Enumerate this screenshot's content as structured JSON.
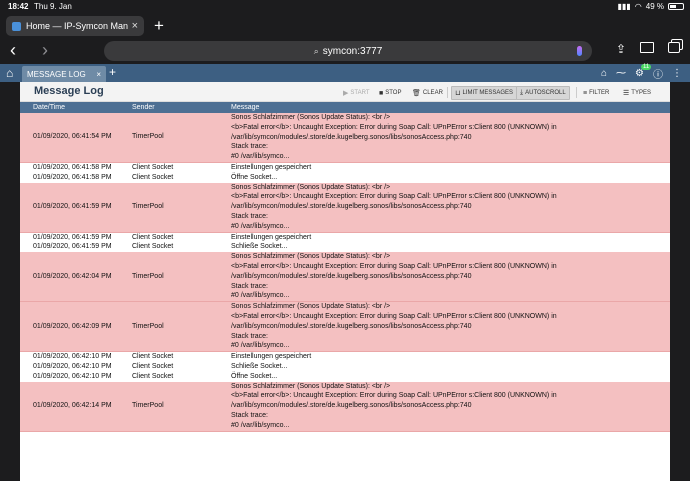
{
  "status": {
    "time": "18:42",
    "date": "Thu 9. Jan",
    "battery": "49 %",
    "battery_level": 0.49
  },
  "browser": {
    "tab_title": "Home — IP-Symcon Man",
    "url": "symcon:3777"
  },
  "app": {
    "tab_label": "MESSAGE LOG",
    "notification_count": "11"
  },
  "panel": {
    "title": "Message Log",
    "toolbar": {
      "start": "START",
      "stop": "STOP",
      "clear": "CLEAR",
      "limit": "LIMIT MESSAGES",
      "autoscroll": "AUTOSCROLL",
      "filter": "FILTER",
      "types": "TYPES"
    },
    "columns": [
      "Date/Time",
      "Sender",
      "Message"
    ]
  },
  "rows": [
    {
      "type": "err",
      "dt": "01/09/2020, 06:41:54 PM",
      "sender": "TimerPool",
      "message": "Sonos Schlafzimmer (Sonos Update Status): <br />\n<b>Fatal error</b>: Uncaught Exception: Error during Soap Call: UPnPError s:Client 800 (UNKNOWN) in\n/var/lib/symcon/modules/.store/de.kugelberg.sonos/libs/sonosAccess.php:740\nStack trace:\n#0 /var/lib/symco..."
    },
    {
      "type": "info",
      "dt": "01/09/2020, 06:41:58 PM",
      "sender": "Client Socket",
      "message": "Einstellungen gespeichert"
    },
    {
      "type": "info",
      "dt": "01/09/2020, 06:41:58 PM",
      "sender": "Client Socket",
      "message": "Öffne Socket..."
    },
    {
      "type": "err",
      "dt": "01/09/2020, 06:41:59 PM",
      "sender": "TimerPool",
      "message": "Sonos Schlafzimmer (Sonos Update Status): <br />\n<b>Fatal error</b>: Uncaught Exception: Error during Soap Call: UPnPError s:Client 800 (UNKNOWN) in\n/var/lib/symcon/modules/.store/de.kugelberg.sonos/libs/sonosAccess.php:740\nStack trace:\n#0 /var/lib/symco..."
    },
    {
      "type": "info",
      "dt": "01/09/2020, 06:41:59 PM",
      "sender": "Client Socket",
      "message": "Einstellungen gespeichert"
    },
    {
      "type": "info",
      "dt": "01/09/2020, 06:41:59 PM",
      "sender": "Client Socket",
      "message": "Schließe Socket..."
    },
    {
      "type": "err",
      "dt": "01/09/2020, 06:42:04 PM",
      "sender": "TimerPool",
      "message": "Sonos Schlafzimmer (Sonos Update Status): <br />\n<b>Fatal error</b>: Uncaught Exception: Error during Soap Call: UPnPError s:Client 800 (UNKNOWN) in\n/var/lib/symcon/modules/.store/de.kugelberg.sonos/libs/sonosAccess.php:740\nStack trace:\n#0 /var/lib/symco..."
    },
    {
      "type": "err",
      "dt": "01/09/2020, 06:42:09 PM",
      "sender": "TimerPool",
      "message": "Sonos Schlafzimmer (Sonos Update Status): <br />\n<b>Fatal error</b>: Uncaught Exception: Error during Soap Call: UPnPError s:Client 800 (UNKNOWN) in\n/var/lib/symcon/modules/.store/de.kugelberg.sonos/libs/sonosAccess.php:740\nStack trace:\n#0 /var/lib/symco..."
    },
    {
      "type": "info",
      "dt": "01/09/2020, 06:42:10 PM",
      "sender": "Client Socket",
      "message": "Einstellungen gespeichert"
    },
    {
      "type": "info",
      "dt": "01/09/2020, 06:42:10 PM",
      "sender": "Client Socket",
      "message": "Schließe Socket..."
    },
    {
      "type": "info",
      "dt": "01/09/2020, 06:42:10 PM",
      "sender": "Client Socket",
      "message": "Öffne Socket..."
    },
    {
      "type": "err",
      "dt": "01/09/2020, 06:42:14 PM",
      "sender": "TimerPool",
      "message": "Sonos Schlafzimmer (Sonos Update Status): <br />\n<b>Fatal error</b>: Uncaught Exception: Error during Soap Call: UPnPError s:Client 800 (UNKNOWN) in\n/var/lib/symcon/modules/.store/de.kugelberg.sonos/libs/sonosAccess.php:740\nStack trace:\n#0 /var/lib/symco..."
    }
  ]
}
